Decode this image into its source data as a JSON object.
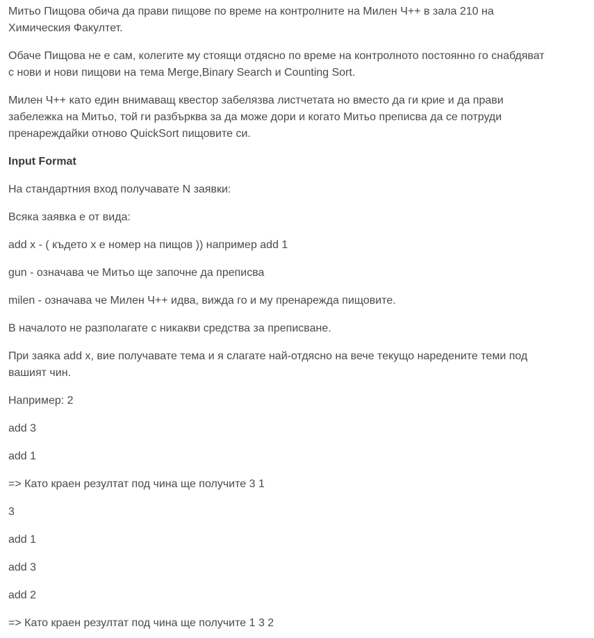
{
  "intro": {
    "p1": [
      "Митьо Пищова обича да прави пищове по време на контролните на Милен Ч++ в зала 210 на",
      "Химическия Факултет."
    ],
    "p2": [
      "Обаче Пищова не е сам, колегите му стоящи отдясно по време на контролното постоянно го снабдяват",
      "с нови и нови пищови на тема Merge,Binary Search и Counting Sort."
    ],
    "p3": [
      "Милен Ч++ като един внимаващ квестор забелязва листчетата но вместо да ги крие и да прави",
      "забележка на Митьо, той ги разбърква за да може дори и когато Митьо преписва да се потруди",
      "пренареждайки отново QuickSort пищовите си."
    ]
  },
  "input_format": {
    "heading": "Input Format",
    "lines": [
      "На стандартния вход получавате N заявки:",
      "Всяка заявка е от вида:",
      "add x - ( където x е номер на пищов )) например add 1",
      "gun - означава че Митьо ще започне да преписва",
      "milen - означава че Милен Ч++ идва, вижда го и му пренарежда пищовите.",
      "В началото не разполагате с никакви средства за преписване."
    ],
    "rule": [
      "При заяка add x, вие получавате тема и я слагате най-отдясно на вече текущо наредените теми под",
      "вашият чин."
    ]
  },
  "examples": {
    "lines": [
      "Например: 2",
      "add 3",
      "add 1",
      "=> Като краен резултат под чина ще получите 3 1",
      "3",
      "add 1",
      "add 3",
      "add 2",
      "=> Като краен резултат под чина ще получите 1 3 2"
    ]
  }
}
